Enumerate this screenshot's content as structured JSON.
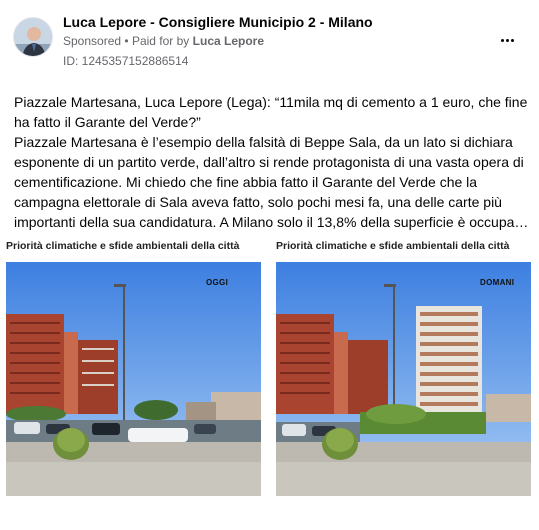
{
  "post": {
    "page_name": "Luca Lepore - Consigliere Municipio 2 - Milano",
    "sponsored_label": "Sponsored",
    "separator": "•",
    "paid_for_prefix": "Paid for by",
    "paid_for_name": "Luca Lepore",
    "ad_id": "ID: 1245357152886514",
    "more_icon": "more-horizontal-icon",
    "text_line1": "Piazzale Martesana, Luca Lepore (Lega): “11mila mq di cemento a 1 euro, che fine ha fatto il Garante del Verde?”",
    "text_line2": "Piazzale Martesana è l’esempio della falsità di Beppe Sala, da un lato si dichiara esponente di un partito verde, dall’altro si rende protagonista di una vasta opera di cementificazione. Mi chiedo che fine abbia fatto il Garante del Verde che la campagna elettorale di Sala aveva fatto, solo pochi mesi fa, una delle carte più importanti della sua candidatura. A Milano solo il 13,8% della superficie è occupa…"
  },
  "image": {
    "left_title": "Priorità climatiche e sfide ambientali della città",
    "right_title": "Priorità climatiche e sfide ambientali della città",
    "left_tag": "OGGI",
    "right_tag": "DOMANI"
  },
  "colors": {
    "sky_top": "#3d7fe0",
    "sky_bottom": "#9cc4f2",
    "brick": "#b04a30",
    "pavement": "#b9b6ad",
    "text_secondary": "#65676b"
  }
}
